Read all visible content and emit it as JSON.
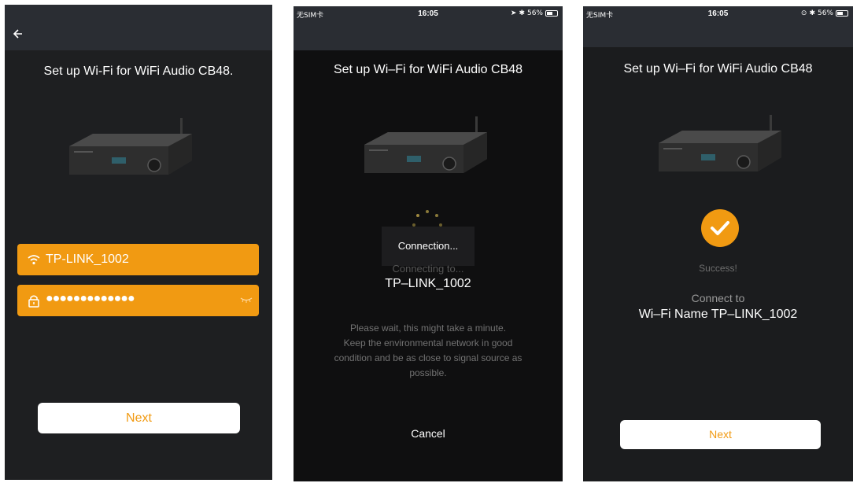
{
  "screen1": {
    "title": "Set up Wi-Fi for WiFi Audio CB48.",
    "ssid": "TP-LINK_1002",
    "password_mask": "●●●●●●●●●●●●●",
    "next_label": "Next"
  },
  "screen2": {
    "status": {
      "carrier": "无SIM卡",
      "time": "16:05",
      "battery": "56%"
    },
    "title": "Set up Wi–Fi for WiFi Audio CB48",
    "toast": "Connection...",
    "connecting_to": "Connecting to...",
    "ssid": "TP–LINK_1002",
    "wait_lines": [
      "Please wait, this might take a minute.",
      "Keep the environmental network in good",
      "condition and be as close to signal source as",
      "possible."
    ],
    "cancel_label": "Cancel"
  },
  "screen3": {
    "status": {
      "carrier": "无SIM卡",
      "time": "16:05",
      "battery": "56%"
    },
    "title": "Set up Wi–Fi for WiFi Audio CB48",
    "success": "Success!",
    "connect_to": "Connect to",
    "wifi_name": "Wi–Fi Name TP–LINK_1002",
    "next_label": "Next"
  },
  "colors": {
    "accent": "#f19a12",
    "topbar": "#2a2d33",
    "background": "#1e1f21"
  },
  "icons": [
    "back-arrow-icon",
    "wifi-icon",
    "lock-icon",
    "eye-closed-icon",
    "spinner-icon",
    "checkmark-icon",
    "location-icon",
    "bluetooth-icon",
    "battery-icon"
  ]
}
